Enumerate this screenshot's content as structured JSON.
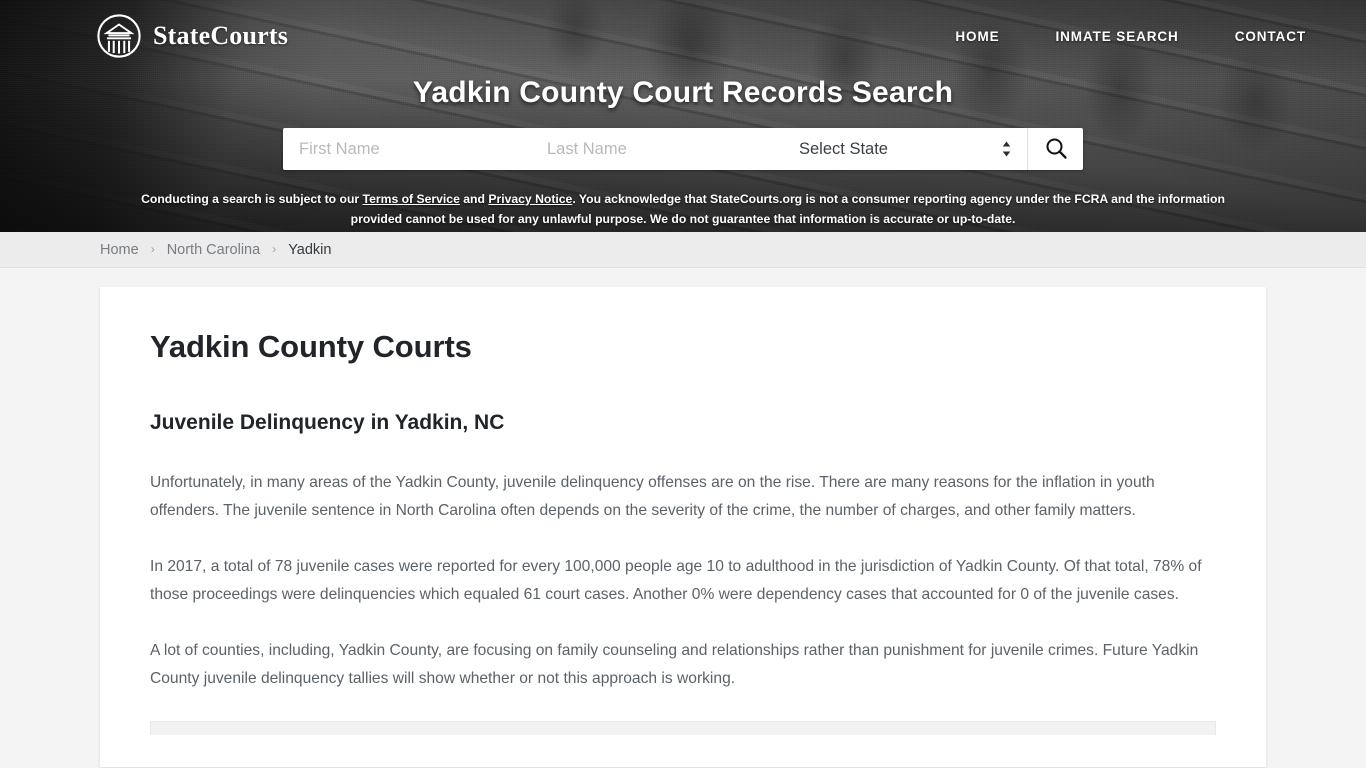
{
  "header": {
    "brand_name": "StateCourts",
    "logo_icon": "courthouse-circle-icon",
    "nav": [
      {
        "label": "HOME",
        "name": "nav-home"
      },
      {
        "label": "INMATE SEARCH",
        "name": "nav-inmate-search"
      },
      {
        "label": "CONTACT",
        "name": "nav-contact"
      }
    ],
    "hero_title": "Yadkin County Court Records Search"
  },
  "search": {
    "first_name_placeholder": "First Name",
    "first_name_value": "",
    "last_name_placeholder": "Last Name",
    "last_name_value": "",
    "state_selected": "Select State",
    "search_icon": "magnifier-icon",
    "select_arrows_icon": "chevron-up-down-icon"
  },
  "disclaimer": {
    "part1": "Conducting a search is subject to our ",
    "link1": "Terms of Service",
    "part2": " and ",
    "link2": "Privacy Notice",
    "part3": ". You acknowledge that StateCourts.org is not a consumer reporting agency under the FCRA and the information provided cannot be used for any unlawful purpose. We do not guarantee that information is accurate or up-to-date."
  },
  "breadcrumb": {
    "separator": "›",
    "items": [
      {
        "label": "Home",
        "active": false
      },
      {
        "label": "North Carolina",
        "active": false
      },
      {
        "label": "Yadkin",
        "active": true
      }
    ]
  },
  "main": {
    "page_title": "Yadkin County Courts",
    "section_title": "Juvenile Delinquency in Yadkin, NC",
    "paragraphs": [
      "Unfortunately, in many areas of the Yadkin County, juvenile delinquency offenses are on the rise. There are many reasons for the inflation in youth offenders. The juvenile sentence in North Carolina often depends on the severity of the crime, the number of charges, and other family matters.",
      "In 2017, a total of 78 juvenile cases were reported for every 100,000 people age 10 to adulthood in the jurisdiction of Yadkin County. Of that total, 78% of those proceedings were delinquencies which equaled 61 court cases. Another 0% were dependency cases that accounted for 0 of the juvenile cases.",
      "A lot of counties, including, Yadkin County, are focusing on family counseling and relationships rather than punishment for juvenile crimes. Future Yadkin County juvenile delinquency tallies will show whether or not this approach is working."
    ]
  },
  "colors": {
    "hero_overlay": "#5d5d5d",
    "breadcrumb_bg": "#ececec",
    "page_bg": "#f4f4f4",
    "card_bg": "#ffffff",
    "heading": "#212529",
    "body_text": "#5b6268",
    "muted_link": "#777d83"
  }
}
